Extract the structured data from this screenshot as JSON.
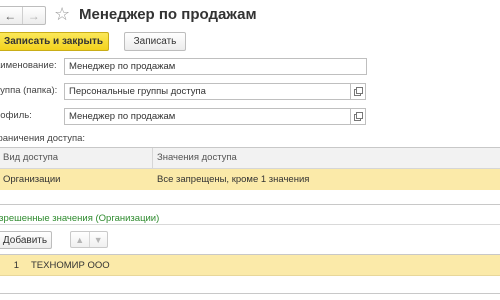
{
  "header": {
    "title": "Менеджер по продажам",
    "back_glyph": "←",
    "forward_glyph": "→",
    "star_glyph": "☆"
  },
  "toolbar": {
    "save_close_label": "Записать и закрыть",
    "save_label": "Записать"
  },
  "form": {
    "name_label": "аименование:",
    "name_value": "Менеджер по продажам",
    "group_label": "руппа (папка):",
    "group_value": "Персональные группы доступа",
    "profile_label": "рофиль:",
    "profile_value": "Менеджер по продажам"
  },
  "restrictions": {
    "section_label": "граничения доступа:",
    "columns": [
      "Вид доступа",
      "Значения доступа"
    ],
    "rows": [
      {
        "type": "Организации",
        "values": "Все запрещены, кроме 1 значения"
      }
    ]
  },
  "allowed": {
    "title": "азрешенные значения (Организации)",
    "add_label": "Добавить",
    "up_glyph": "▲",
    "down_glyph": "▼",
    "rows": [
      {
        "num": "1",
        "value": "ТЕХНОМИР ООО"
      }
    ]
  },
  "colors": {
    "accent_button": "#f3d21c",
    "selection": "#fbeaa9",
    "green_title": "#2e8b2e"
  }
}
